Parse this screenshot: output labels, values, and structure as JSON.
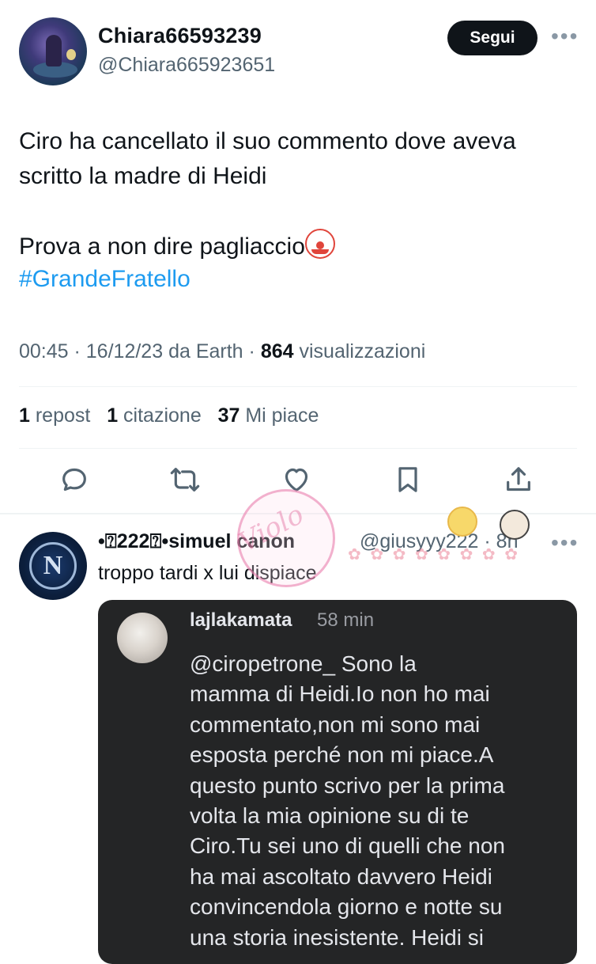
{
  "tweet": {
    "display_name": "Chiara66593239",
    "handle": "@Chiara665923651",
    "follow_label": "Segui",
    "more_icon": "more-horizontal-icon",
    "text_lines": [
      "Ciro ha cancellato il suo commento dove aveva",
      "scritto la madre di Heidi"
    ],
    "text_line_3": "Prova a non dire pagliaccio",
    "emoji": "clown-face-emoji",
    "hashtag": "#GrandeFratello",
    "time": "00:45",
    "date": "16/12/23",
    "source_prefix": "da",
    "source": "Earth",
    "views_count": "864",
    "views_label": "visualizzazioni",
    "reposts_count": "1",
    "reposts_label": "repost",
    "quotes_count": "1",
    "quotes_label": "citazione",
    "likes_count": "37",
    "likes_label": "Mi piace"
  },
  "actions": {
    "reply_icon": "reply-icon",
    "repost_icon": "repost-icon",
    "like_icon": "heart-icon",
    "bookmark_icon": "bookmark-icon",
    "share_icon": "share-icon",
    "icon_color": "#536471"
  },
  "reply": {
    "name": "•⍰222⍰•simuel canon",
    "handle_time": "@giusyyy222 · 8h",
    "text": "troppo tardi x lui dispiace",
    "screenshot": {
      "username": "lajlakamata",
      "time": "58 min",
      "body_lines": [
        "@ciropetrone_ Sono la",
        "mamma di Heidi.Io non ho mai",
        "commentato,non mi sono mai",
        "esposta perché non mi piace.A",
        "questo punto scrivo per la prima",
        "volta la mia opinione su di te",
        "Ciro.Tu sei uno di quelli che non",
        "ha mai ascoltato davvero Heidi",
        "convincendola giorno e notte su",
        "una storia inesistente. Heidi si"
      ]
    }
  },
  "watermark": {
    "text": "Violo"
  },
  "colors": {
    "text": "#0f1419",
    "secondary": "#536471",
    "link": "#1d9bf0",
    "follow_bg": "#0f1419",
    "dark_card": "#242526"
  }
}
